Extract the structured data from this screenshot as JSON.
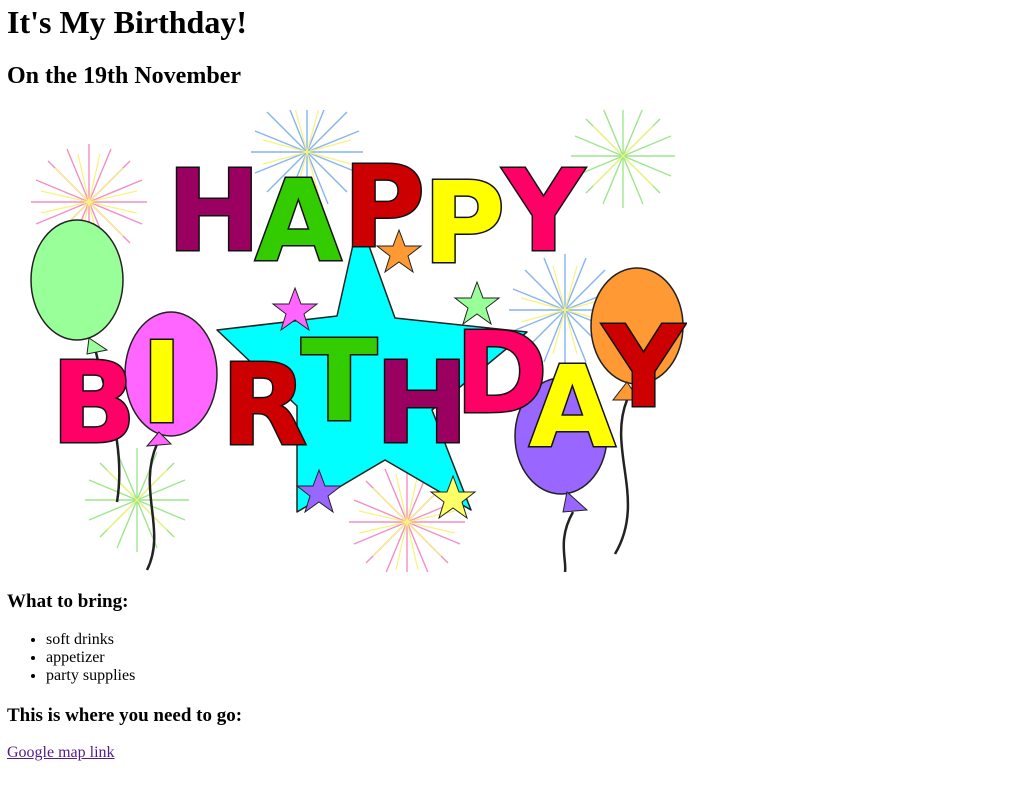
{
  "page": {
    "title": "It's My Birthday!",
    "subtitle": "On the 19th November"
  },
  "banner": {
    "image_name": "happy-birthday-balloons-illustration",
    "row1": "HAPPY",
    "row2": "BIRTHDAY"
  },
  "bring": {
    "heading": "What to bring:",
    "items": [
      "soft drinks",
      "appetizer",
      "party supplies"
    ]
  },
  "directions": {
    "heading": "This is where you need to go:",
    "link_label": "Google map link",
    "link_color": "#551a8b"
  }
}
